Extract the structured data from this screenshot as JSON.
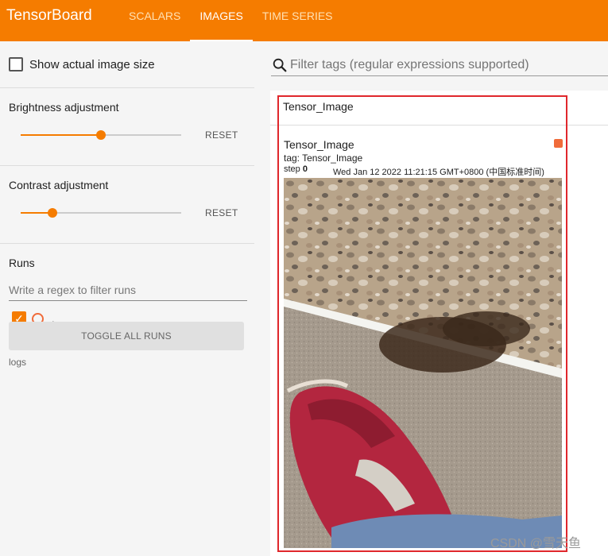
{
  "topbar": {
    "brand": "TensorBoard",
    "tabs": [
      {
        "label": "SCALARS",
        "active": false
      },
      {
        "label": "IMAGES",
        "active": true
      },
      {
        "label": "TIME SERIES",
        "active": false
      }
    ],
    "color": "#f57c00"
  },
  "sidebar": {
    "show_actual_size": {
      "label": "Show actual image size",
      "checked": false
    },
    "brightness": {
      "title": "Brightness adjustment",
      "value": 0.5,
      "reset_label": "RESET"
    },
    "contrast": {
      "title": "Contrast adjustment",
      "value": 0.2,
      "reset_label": "RESET"
    },
    "runs": {
      "title": "Runs",
      "filter_placeholder": "Write a regex to filter runs",
      "items": [
        {
          "name": ".",
          "checked": true,
          "color": "#f06b3a"
        }
      ],
      "toggle_all_label": "TOGGLE ALL RUNS",
      "logdir": "logs"
    }
  },
  "main": {
    "search_placeholder": "Filter tags (regular expressions supported)",
    "card": {
      "header": "Tensor_Image",
      "image_title": "Tensor_Image",
      "tag_line": "tag: Tensor_Image",
      "step_label": "step",
      "step_value": "0",
      "timestamp": "Wed Jan 12 2022 11:21:15 GMT+0800 (中国标准时间)",
      "icon": "expand-icon"
    }
  },
  "watermark": "CSDN @雪天鱼",
  "colors": {
    "accent": "#f57c00",
    "highlight_box": "#e0272c"
  }
}
